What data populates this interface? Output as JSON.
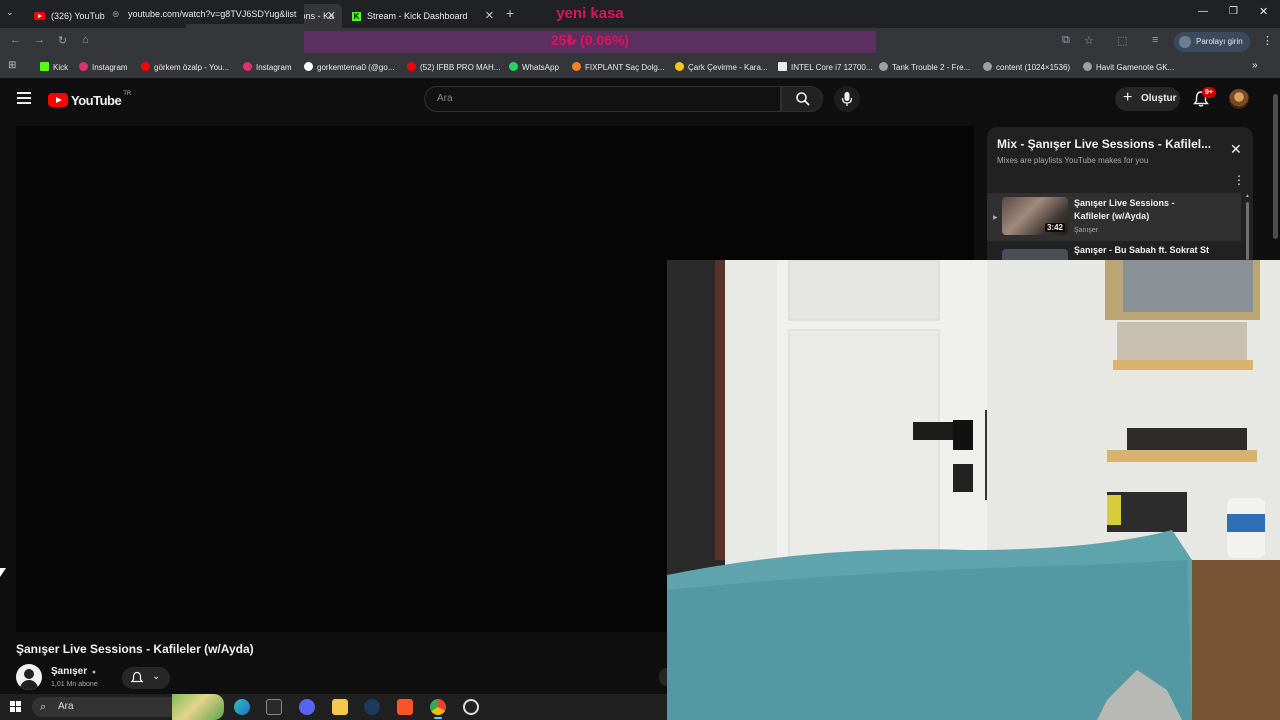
{
  "tabs": [
    {
      "title": "(326) YouTube",
      "active": false
    },
    {
      "title": "(326) Şanışer Live Sessions - Ka",
      "active": true
    },
    {
      "title": "Stream - Kick Dashboard",
      "active": false
    }
  ],
  "overlay": {
    "title": "yeni kasa",
    "percent": "25₺ (0.06%)"
  },
  "browser": {
    "url": "youtube.com/watch?v=g8TVJ6SDYug&list",
    "profile_label": "Parolayı girin"
  },
  "bookmarks": [
    {
      "label": "Kick",
      "color": "#53fc18"
    },
    {
      "label": "Instagram",
      "color": "#e1306c"
    },
    {
      "label": "görkem özalp - You...",
      "color": "#ff0000"
    },
    {
      "label": "Instagram",
      "color": "#e1306c"
    },
    {
      "label": "gorkemtema0 (@go...",
      "color": "#ffffff"
    },
    {
      "label": "(52) IFBB PRO MAH...",
      "color": "#ff0000"
    },
    {
      "label": "WhatsApp",
      "color": "#25d366"
    },
    {
      "label": "FIXPLANT Saç Dolg...",
      "color": "#f58220"
    },
    {
      "label": "Çark Çevirme - Kara...",
      "color": "#f5c518"
    },
    {
      "label": "INTEL Core i7 12700...",
      "color": "#e8eaed"
    },
    {
      "label": "Tank Trouble 2 - Fre...",
      "color": "#9aa0a6"
    },
    {
      "label": "content (1024×1536)",
      "color": "#9aa0a6"
    },
    {
      "label": "Havit Gamenote GK...",
      "color": "#9aa0a6"
    }
  ],
  "youtube": {
    "logo_text": "YouTube",
    "region": "TR",
    "search_placeholder": "Ara",
    "create_label": "Oluştur",
    "notif_count": "9+"
  },
  "playlist": {
    "title": "Mix - Şanışer Live Sessions - Kafilel...",
    "subtitle": "Mixes are playlists YouTube makes for you",
    "items": [
      {
        "title": "Şanışer Live Sessions - Kafileler (w/Ayda)",
        "channel": "Şanışer",
        "duration": "3:42"
      },
      {
        "title": "Şanışer - Bu Sabah ft. Sokrat St",
        "channel": "",
        "duration": ""
      }
    ]
  },
  "video": {
    "title": "Şanışer Live Sessions - Kafileler (w/Ayda)",
    "channel": "Şanışer",
    "subscribers": "1,01 Mn abone"
  },
  "taskbar": {
    "search_label": "Ara"
  }
}
